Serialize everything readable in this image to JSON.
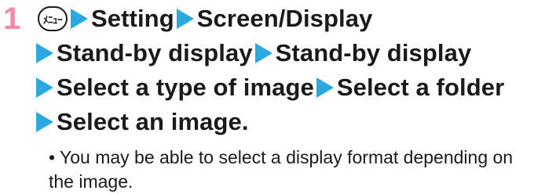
{
  "step": {
    "number": "1",
    "menu_key_label": "メニュー",
    "items": [
      "Setting",
      "Screen/Display",
      "Stand-by display",
      "Stand-by display",
      "Select a type of image",
      "Select a folder",
      "Select an image."
    ]
  },
  "note": {
    "bullet": "•",
    "text": "You may be able to select a display format depending on the image."
  },
  "colors": {
    "step_number": "#ef8aa8",
    "arrow": "#2aa9e0",
    "text": "#1a1a1a"
  },
  "icons": {
    "menu_key": "menu-key-icon",
    "arrow": "right-arrow-icon"
  }
}
